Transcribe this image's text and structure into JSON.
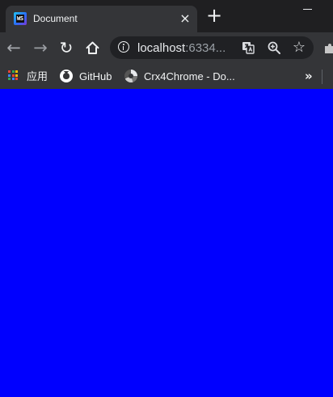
{
  "browser": {
    "tab": {
      "title": "Document",
      "favicon": "webstorm-icon",
      "favicon_text": "WS"
    },
    "address_bar": {
      "url_host": "localhost",
      "url_rest": ":6334..."
    },
    "bookmarks": [
      {
        "label": "应用",
        "icon": "apps-icon"
      },
      {
        "label": "GitHub",
        "icon": "github-icon"
      },
      {
        "label": "Crx4Chrome - Do...",
        "icon": "crx4chrome-icon"
      }
    ],
    "page": {
      "background": "#0000ff"
    }
  }
}
